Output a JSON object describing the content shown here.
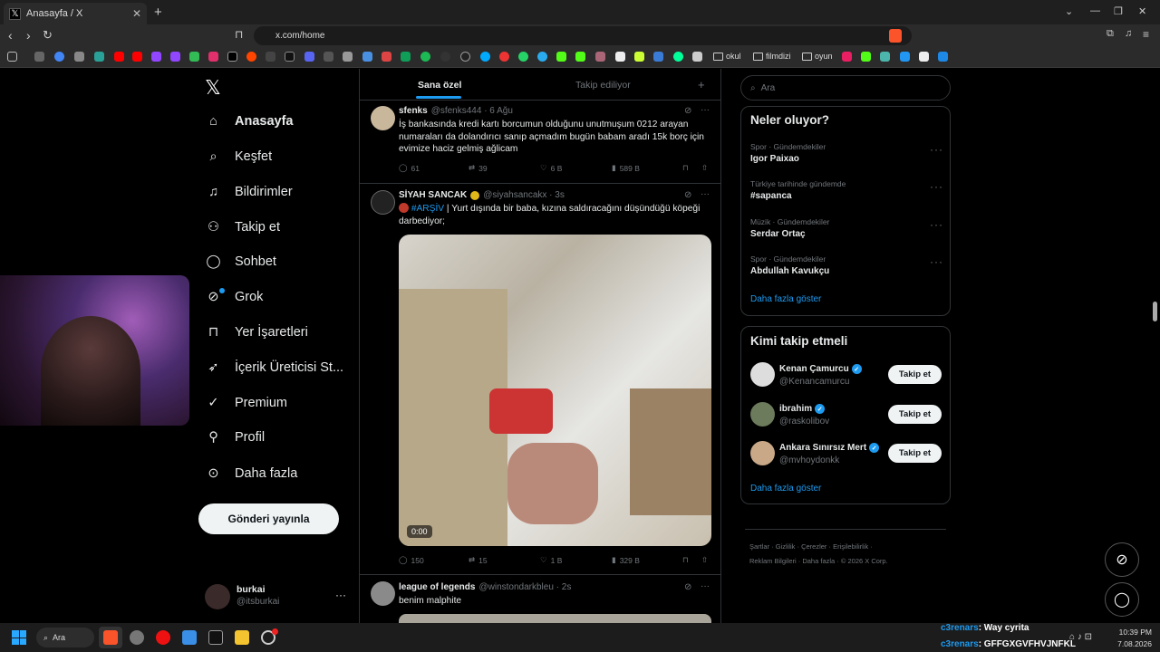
{
  "browser": {
    "tab_title": "Anasayfa / X",
    "url": "x.com/home",
    "bookmarks": [
      "okul",
      "filmdizi",
      "oyun"
    ]
  },
  "nav": {
    "items": [
      {
        "label": "Anasayfa",
        "icon": "home-icon"
      },
      {
        "label": "Keşfet",
        "icon": "search-icon"
      },
      {
        "label": "Bildirimler",
        "icon": "bell-icon"
      },
      {
        "label": "Takip et",
        "icon": "user-plus-icon"
      },
      {
        "label": "Sohbet",
        "icon": "chat-icon"
      },
      {
        "label": "Grok",
        "icon": "grok-icon"
      },
      {
        "label": "Yer İşaretleri",
        "icon": "bookmark-icon"
      },
      {
        "label": "İçerik Üreticisi St...",
        "icon": "rocket-icon"
      },
      {
        "label": "Premium",
        "icon": "verified-icon"
      },
      {
        "label": "Profil",
        "icon": "person-icon"
      },
      {
        "label": "Daha fazla",
        "icon": "more-icon"
      }
    ],
    "post_button": "Gönderi yayınla",
    "account": {
      "name": "burkai",
      "handle": "@itsburkai"
    }
  },
  "feed": {
    "tabs": [
      "Sana özel",
      "Takip ediliyor"
    ],
    "posts": [
      {
        "name": "sfenks",
        "handle": "@sfenks444 · 6 Ağu",
        "text": "İş bankasında kredi kartı borcumun olduğunu unutmuşum 0212 arayan numaraları da dolandırıcı sanıp açmadım bugün babam aradı 15k borç için evimize haciz gelmiş ağlicam",
        "replies": "61",
        "reposts": "39",
        "likes": "6 B",
        "views": "589 B"
      },
      {
        "name": "SİYAH SANCAK",
        "handle": "@siyahsancakx · 3s",
        "tag": "#ARŞİV",
        "text": " | Yurt dışında bir baba, kızına saldıracağını düşündüğü köpeği darbediyor;",
        "video_time": "0:00",
        "replies": "150",
        "reposts": "15",
        "likes": "1 B",
        "views": "329 B"
      },
      {
        "name": "league of legends",
        "handle": "@winstondarkbleu · 2s",
        "text": "benim malphite"
      }
    ]
  },
  "right": {
    "search_placeholder": "Ara",
    "trends_title": "Neler oluyor?",
    "trends": [
      {
        "meta": "Spor · Gündemdekiler",
        "name": "Igor Paixao"
      },
      {
        "meta": "Türkiye tarihinde gündemde",
        "name": "#sapanca"
      },
      {
        "meta": "Müzik · Gündemdekiler",
        "name": "Serdar Ortaç"
      },
      {
        "meta": "Spor · Gündemdekiler",
        "name": "Abdullah Kavukçu"
      }
    ],
    "show_more": "Daha fazla göster",
    "follow_title": "Kimi takip etmeli",
    "follow": [
      {
        "name": "Kenan Çamurcu",
        "handle": "@Kenancamurcu",
        "button": "Takip et"
      },
      {
        "name": "ibrahim",
        "handle": "@raskolibov",
        "button": "Takip et"
      },
      {
        "name": "Ankara Sınırsız Mert",
        "handle": "@mvhoydonkk",
        "button": "Takip et"
      }
    ],
    "footer1": "Şartlar · Gizlilik · Çerezler · Erişilebilirlik ·",
    "footer2": "Reklam Bilgileri · Daha fazla · © 2026 X Corp."
  },
  "overlay_chat": [
    {
      "user": "c3renars",
      "msg": ": Way cyrita"
    },
    {
      "user": "c3renars",
      "msg": ": GFFGXGVFHVJNFKL"
    }
  ],
  "taskbar": {
    "search": "Ara",
    "time": "10:39 PM",
    "date": "7.08.2026"
  },
  "colors": {
    "accent": "#1d9bf0",
    "background": "#000000",
    "border": "#2f3336"
  }
}
